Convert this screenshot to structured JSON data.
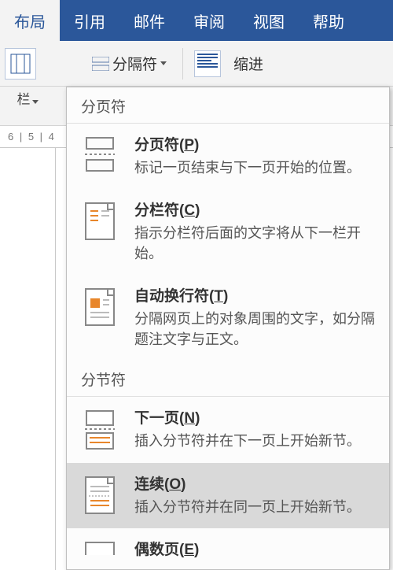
{
  "tabs": {
    "layout": "布局",
    "references": "引用",
    "mail": "邮件",
    "review": "审阅",
    "view": "视图",
    "help": "帮助"
  },
  "toolbar": {
    "breaks_label": "分隔符",
    "indent_label": "缩进",
    "columns_label": "栏"
  },
  "ruler_text": "6  | 5 | 4",
  "menu": {
    "section_page": "分页符",
    "section_section": "分节符",
    "items": {
      "pagebreak": {
        "title_pre": "分页符(",
        "hotkey": "P",
        "title_post": ")",
        "desc": "标记一页结束与下一页开始的位置。"
      },
      "colbreak": {
        "title_pre": "分栏符(",
        "hotkey": "C",
        "title_post": ")",
        "desc": "指示分栏符后面的文字将从下一栏开始。"
      },
      "textwrap": {
        "title_pre": "自动换行符(",
        "hotkey": "T",
        "title_post": ")",
        "desc": "分隔网页上的对象周围的文字，如分隔题注文字与正文。"
      },
      "nextpage": {
        "title_pre": "下一页(",
        "hotkey": "N",
        "title_post": ")",
        "desc": "插入分节符并在下一页上开始新节。"
      },
      "continuous": {
        "title_pre": "连续(",
        "hotkey": "O",
        "title_post": ")",
        "desc": "插入分节符并在同一页上开始新节。"
      },
      "evenpage": {
        "title_pre": "偶数页(",
        "hotkey": "E",
        "title_post": ")",
        "desc": ""
      }
    }
  }
}
